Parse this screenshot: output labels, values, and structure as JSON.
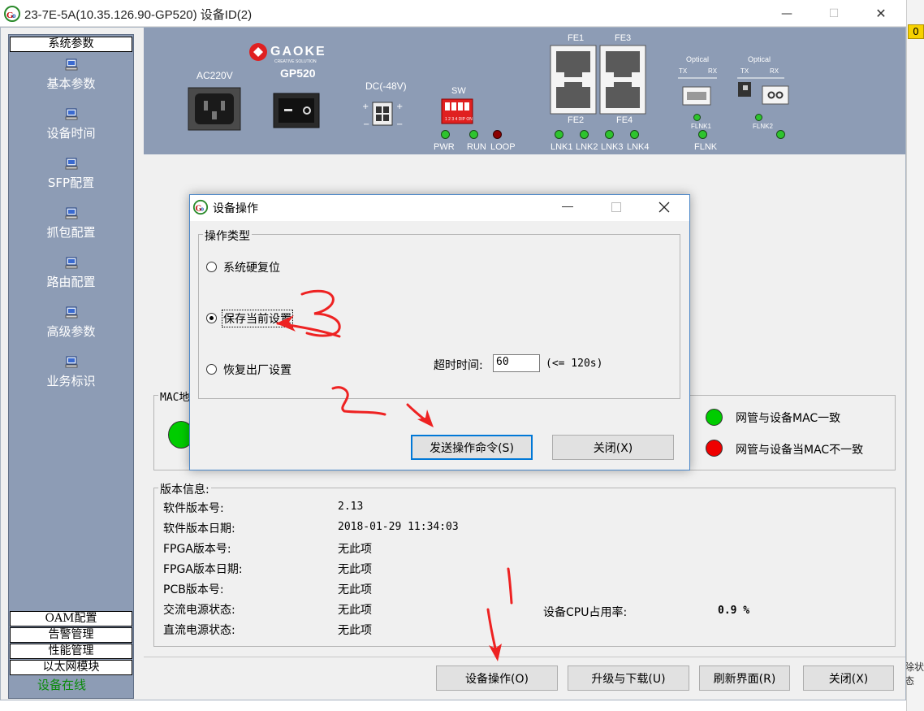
{
  "window": {
    "title": "23-7E-5A(10.35.126.90-GP520)  设备ID(2)",
    "minimize": "—",
    "maximize": "☐",
    "close": "✕"
  },
  "right_strip": {
    "badge": "0",
    "bottom_text": "除状态"
  },
  "sidebar": {
    "header": "系统参数",
    "items": [
      {
        "label": "基本参数",
        "icon": "computer-icon"
      },
      {
        "label": "设备时间",
        "icon": "computer-icon"
      },
      {
        "label": "SFP配置",
        "icon": "computer-icon"
      },
      {
        "label": "抓包配置",
        "icon": "computer-icon"
      },
      {
        "label": "路由配置",
        "icon": "computer-icon"
      },
      {
        "label": "高级参数",
        "icon": "computer-icon"
      },
      {
        "label": "业务标识",
        "icon": "computer-icon"
      }
    ],
    "bottom_tabs": [
      "OAM配置",
      "告警管理",
      "性能管理",
      "以太网模块"
    ],
    "online_label": "设备在线"
  },
  "device_panel": {
    "ac_label": "AC220V",
    "brand": "GAOKE",
    "brand_sub": "CREATIVE SOLUTION",
    "model": "GP520",
    "dc_label": "DC(-48V)",
    "sw_label": "SW",
    "sw_small": "1 2 3 4  DIP  ON",
    "leds_left": [
      "PWR",
      "RUN",
      "LOOP"
    ],
    "fe_ports": [
      "FE1",
      "FE3",
      "FE2",
      "FE4"
    ],
    "lnk_leds": [
      "LNK1",
      "LNK2",
      "LNK3",
      "LNK4"
    ],
    "optical1": {
      "label": "Optical",
      "tx": "TX",
      "rx": "RX",
      "led": "FLNK1"
    },
    "optical2": {
      "label": "Optical",
      "tx": "TX",
      "rx": "RX",
      "led": "FLNK2"
    },
    "flnk": "FLNK",
    "colors": {
      "panel": "#8d9cb5",
      "led_green": "#2ec42e",
      "led_red": "#8b0000"
    }
  },
  "mac_group": {
    "title": "MAC地",
    "legend_match": "网管与设备MAC一致",
    "legend_mismatch": "网管与设备当MAC不一致",
    "colors": {
      "match": "#00cc00",
      "mismatch": "#ee0000"
    }
  },
  "version": {
    "title": "版本信息:",
    "rows": [
      {
        "label": "软件版本号:",
        "value": "2.13"
      },
      {
        "label": "软件版本日期:",
        "value": "2018-01-29 11:34:03"
      },
      {
        "label": "FPGA版本号:",
        "value": "无此项"
      },
      {
        "label": "FPGA版本日期:",
        "value": "无此项"
      },
      {
        "label": "PCB版本号:",
        "value": "无此项"
      },
      {
        "label": "交流电源状态:",
        "value": "无此项"
      },
      {
        "label": "直流电源状态:",
        "value": "无此项"
      }
    ],
    "cpu_label": "设备CPU占用率:",
    "cpu_value": "0.9 %"
  },
  "bottom_buttons": {
    "device_op": "设备操作(O)",
    "upgrade": "升级与下载(U)",
    "refresh": "刷新界面(R)",
    "close": "关闭(X)"
  },
  "dialog": {
    "title": "设备操作",
    "group_title": "操作类型",
    "options": [
      "系统硬复位",
      "保存当前设置",
      "恢复出厂设置"
    ],
    "selected_index": 1,
    "timeout_label": "超时时间:",
    "timeout_value": "60",
    "timeout_hint": "(<= 120s)",
    "send_button": "发送操作命令(S)",
    "close_button": "关闭(X)"
  },
  "annotations": [
    "1",
    "2",
    "3"
  ]
}
